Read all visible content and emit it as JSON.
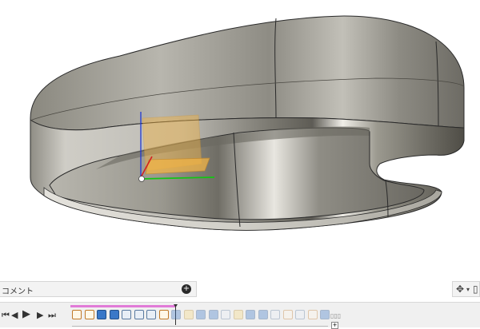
{
  "comments": {
    "label": "コメント",
    "add_icon": "plus-circle-icon"
  },
  "nav_tools": {
    "orbit_icon": "orbit-icon",
    "dropdown_icon": "chevron-down-icon",
    "window_icon": "window-icon"
  },
  "playback": {
    "first_icon": "skip-to-start-icon",
    "prev_icon": "step-back-icon",
    "play_icon": "play-icon",
    "next_icon": "step-forward-icon",
    "last_icon": "skip-to-end-icon"
  },
  "timeline": {
    "features": [
      {
        "type": "sketch",
        "active": true
      },
      {
        "type": "sketch",
        "active": true
      },
      {
        "type": "extrude",
        "active": true
      },
      {
        "type": "extrude",
        "active": true
      },
      {
        "type": "fillet",
        "active": true
      },
      {
        "type": "fillet",
        "active": true
      },
      {
        "type": "fillet",
        "active": true
      },
      {
        "type": "sketch",
        "active": true
      },
      {
        "type": "extrude",
        "active": false
      },
      {
        "type": "plane",
        "active": false
      },
      {
        "type": "extrude",
        "active": false
      },
      {
        "type": "extrude",
        "active": false
      },
      {
        "type": "fillet",
        "active": false
      },
      {
        "type": "plane",
        "active": false
      },
      {
        "type": "extrude",
        "active": false
      },
      {
        "type": "extrude",
        "active": false
      },
      {
        "type": "fillet",
        "active": false
      },
      {
        "type": "sketch",
        "active": false
      },
      {
        "type": "fillet",
        "active": false
      },
      {
        "type": "sketch",
        "active": false
      },
      {
        "type": "extrude",
        "active": false
      }
    ],
    "group_label": "▯▯▯"
  },
  "colors": {
    "model_dark": "#5a5850",
    "model_light": "#e2e0da",
    "sketch_plane": "#f2b445",
    "axis_red": "#d42020",
    "axis_green": "#14c414",
    "axis_blue": "#2038d4",
    "timeline_highlight": "#e17bd8"
  }
}
